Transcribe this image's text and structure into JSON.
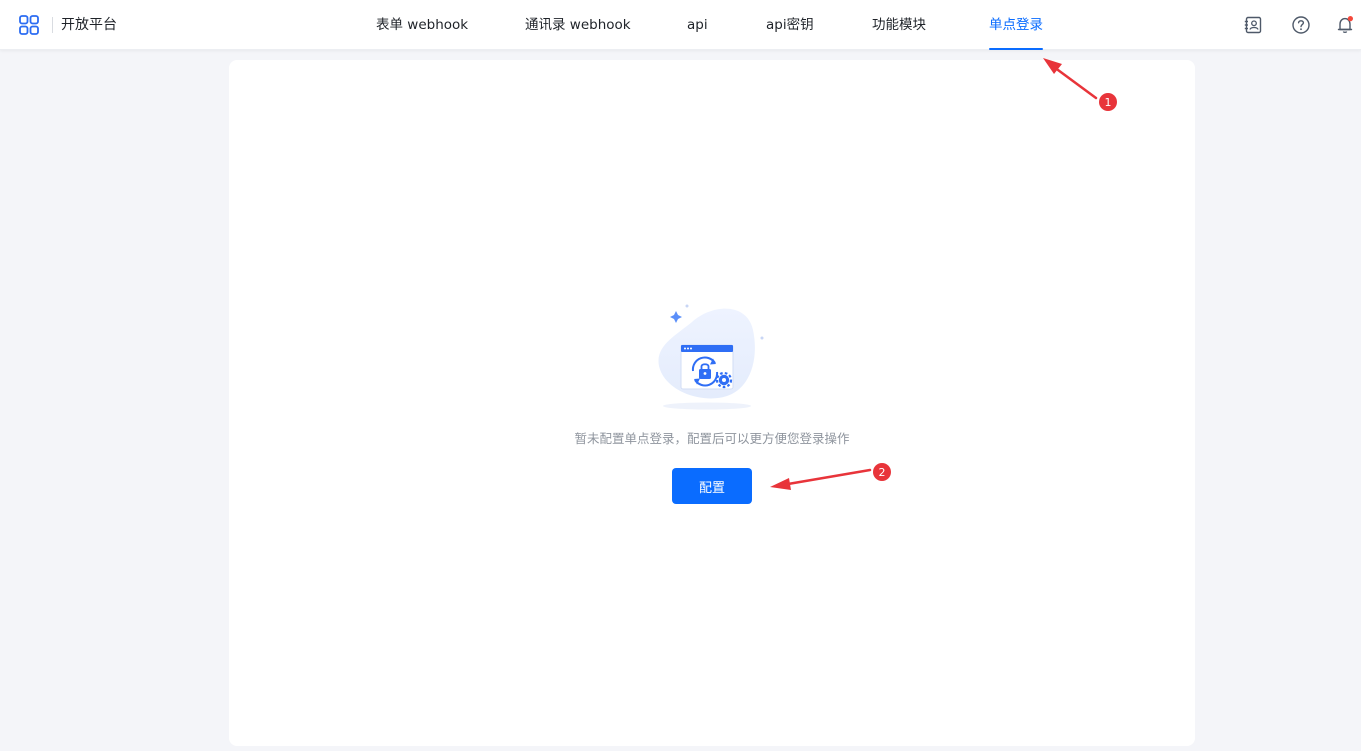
{
  "header": {
    "brand_name": "开放平台",
    "brand_icon": "app-grid-icon",
    "nav": [
      {
        "label": "表单 webhook",
        "active": false
      },
      {
        "label": "通讯录 webhook",
        "active": false
      },
      {
        "label": "api",
        "active": false
      },
      {
        "label": "api密钥",
        "active": false
      },
      {
        "label": "功能模块",
        "active": false
      },
      {
        "label": "单点登录",
        "active": true
      }
    ],
    "tools": [
      "contacts-icon",
      "help-icon",
      "bell-icon"
    ]
  },
  "main": {
    "empty_text": "暂未配置单点登录，配置后可以更方便您登录操作",
    "config_button": "配置",
    "illustration": "sso-lock-window-icon"
  },
  "annotations": [
    {
      "label": "1"
    },
    {
      "label": "2"
    }
  ],
  "colors": {
    "accent": "#0a6cff",
    "annotation": "#e8343a",
    "background": "#f4f5f9"
  }
}
